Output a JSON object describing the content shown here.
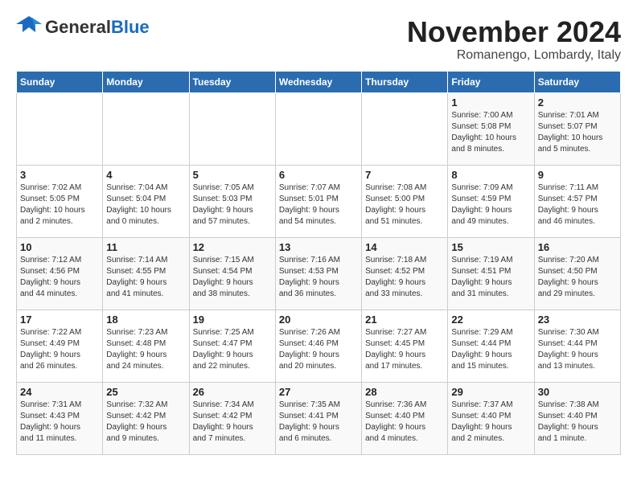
{
  "header": {
    "logo_general": "General",
    "logo_blue": "Blue",
    "month_title": "November 2024",
    "location": "Romanengo, Lombardy, Italy"
  },
  "calendar": {
    "days_of_week": [
      "Sunday",
      "Monday",
      "Tuesday",
      "Wednesday",
      "Thursday",
      "Friday",
      "Saturday"
    ],
    "weeks": [
      [
        {
          "day": "",
          "info": ""
        },
        {
          "day": "",
          "info": ""
        },
        {
          "day": "",
          "info": ""
        },
        {
          "day": "",
          "info": ""
        },
        {
          "day": "",
          "info": ""
        },
        {
          "day": "1",
          "info": "Sunrise: 7:00 AM\nSunset: 5:08 PM\nDaylight: 10 hours\nand 8 minutes."
        },
        {
          "day": "2",
          "info": "Sunrise: 7:01 AM\nSunset: 5:07 PM\nDaylight: 10 hours\nand 5 minutes."
        }
      ],
      [
        {
          "day": "3",
          "info": "Sunrise: 7:02 AM\nSunset: 5:05 PM\nDaylight: 10 hours\nand 2 minutes."
        },
        {
          "day": "4",
          "info": "Sunrise: 7:04 AM\nSunset: 5:04 PM\nDaylight: 10 hours\nand 0 minutes."
        },
        {
          "day": "5",
          "info": "Sunrise: 7:05 AM\nSunset: 5:03 PM\nDaylight: 9 hours\nand 57 minutes."
        },
        {
          "day": "6",
          "info": "Sunrise: 7:07 AM\nSunset: 5:01 PM\nDaylight: 9 hours\nand 54 minutes."
        },
        {
          "day": "7",
          "info": "Sunrise: 7:08 AM\nSunset: 5:00 PM\nDaylight: 9 hours\nand 51 minutes."
        },
        {
          "day": "8",
          "info": "Sunrise: 7:09 AM\nSunset: 4:59 PM\nDaylight: 9 hours\nand 49 minutes."
        },
        {
          "day": "9",
          "info": "Sunrise: 7:11 AM\nSunset: 4:57 PM\nDaylight: 9 hours\nand 46 minutes."
        }
      ],
      [
        {
          "day": "10",
          "info": "Sunrise: 7:12 AM\nSunset: 4:56 PM\nDaylight: 9 hours\nand 44 minutes."
        },
        {
          "day": "11",
          "info": "Sunrise: 7:14 AM\nSunset: 4:55 PM\nDaylight: 9 hours\nand 41 minutes."
        },
        {
          "day": "12",
          "info": "Sunrise: 7:15 AM\nSunset: 4:54 PM\nDaylight: 9 hours\nand 38 minutes."
        },
        {
          "day": "13",
          "info": "Sunrise: 7:16 AM\nSunset: 4:53 PM\nDaylight: 9 hours\nand 36 minutes."
        },
        {
          "day": "14",
          "info": "Sunrise: 7:18 AM\nSunset: 4:52 PM\nDaylight: 9 hours\nand 33 minutes."
        },
        {
          "day": "15",
          "info": "Sunrise: 7:19 AM\nSunset: 4:51 PM\nDaylight: 9 hours\nand 31 minutes."
        },
        {
          "day": "16",
          "info": "Sunrise: 7:20 AM\nSunset: 4:50 PM\nDaylight: 9 hours\nand 29 minutes."
        }
      ],
      [
        {
          "day": "17",
          "info": "Sunrise: 7:22 AM\nSunset: 4:49 PM\nDaylight: 9 hours\nand 26 minutes."
        },
        {
          "day": "18",
          "info": "Sunrise: 7:23 AM\nSunset: 4:48 PM\nDaylight: 9 hours\nand 24 minutes."
        },
        {
          "day": "19",
          "info": "Sunrise: 7:25 AM\nSunset: 4:47 PM\nDaylight: 9 hours\nand 22 minutes."
        },
        {
          "day": "20",
          "info": "Sunrise: 7:26 AM\nSunset: 4:46 PM\nDaylight: 9 hours\nand 20 minutes."
        },
        {
          "day": "21",
          "info": "Sunrise: 7:27 AM\nSunset: 4:45 PM\nDaylight: 9 hours\nand 17 minutes."
        },
        {
          "day": "22",
          "info": "Sunrise: 7:29 AM\nSunset: 4:44 PM\nDaylight: 9 hours\nand 15 minutes."
        },
        {
          "day": "23",
          "info": "Sunrise: 7:30 AM\nSunset: 4:44 PM\nDaylight: 9 hours\nand 13 minutes."
        }
      ],
      [
        {
          "day": "24",
          "info": "Sunrise: 7:31 AM\nSunset: 4:43 PM\nDaylight: 9 hours\nand 11 minutes."
        },
        {
          "day": "25",
          "info": "Sunrise: 7:32 AM\nSunset: 4:42 PM\nDaylight: 9 hours\nand 9 minutes."
        },
        {
          "day": "26",
          "info": "Sunrise: 7:34 AM\nSunset: 4:42 PM\nDaylight: 9 hours\nand 7 minutes."
        },
        {
          "day": "27",
          "info": "Sunrise: 7:35 AM\nSunset: 4:41 PM\nDaylight: 9 hours\nand 6 minutes."
        },
        {
          "day": "28",
          "info": "Sunrise: 7:36 AM\nSunset: 4:40 PM\nDaylight: 9 hours\nand 4 minutes."
        },
        {
          "day": "29",
          "info": "Sunrise: 7:37 AM\nSunset: 4:40 PM\nDaylight: 9 hours\nand 2 minutes."
        },
        {
          "day": "30",
          "info": "Sunrise: 7:38 AM\nSunset: 4:40 PM\nDaylight: 9 hours\nand 1 minute."
        }
      ]
    ]
  }
}
